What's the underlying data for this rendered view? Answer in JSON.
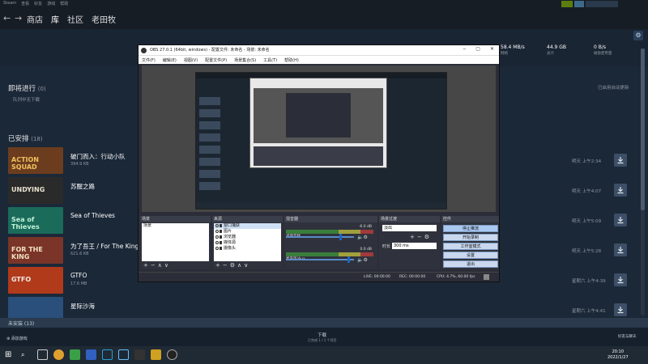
{
  "steam": {
    "top_menu": [
      "Steam",
      "查看",
      "好友",
      "游戏",
      "帮助"
    ],
    "nav": {
      "back": "←",
      "forward": "→",
      "links": [
        "商店",
        "库",
        "社区",
        "老田牧"
      ]
    },
    "stats": [
      {
        "value": "58.4 MB/s",
        "label": "网络"
      },
      {
        "value": "44.9 GB",
        "label": "总计"
      },
      {
        "value": "0 B/s",
        "label": "磁盘使用量"
      }
    ],
    "in_progress": {
      "title": "即将进行",
      "count": "(0)",
      "empty": "队列中无下载",
      "right_label": "已启用自动更新"
    },
    "installed": {
      "title": "已安排",
      "count": "(18)"
    },
    "games": [
      {
        "title": "破门而入：行动小队",
        "size": "394.9 KB",
        "time": "明天 上午2:34",
        "thumb_bg": "#6b3d1e",
        "thumb_text": "ACTION SQUAD",
        "thumb_fg": "#f0c060"
      },
      {
        "title": "苏醒之路",
        "size": "",
        "time": "明天 上午4:07",
        "thumb_bg": "#2a2a2a",
        "thumb_text": "UNDYING",
        "thumb_fg": "#e8e0d0"
      },
      {
        "title": "Sea of Thieves",
        "size": "",
        "time": "明天 上午5:09",
        "thumb_bg": "#1b6b5a",
        "thumb_text": "Sea of Thieves",
        "thumb_fg": "#c0f0d8"
      },
      {
        "title": "为了吾王 / For The King",
        "size": "621.6 KB",
        "time": "明天 上午5:28",
        "thumb_bg": "#7a3528",
        "thumb_text": "FOR THE KING",
        "thumb_fg": "#f0e0c0"
      },
      {
        "title": "GTFO",
        "size": "17.6 MB",
        "time": "星期六 上午4:39",
        "thumb_bg": "#b03a1a",
        "thumb_text": "GTFO",
        "thumb_fg": "#f0e8e0"
      },
      {
        "title": "星际沙海",
        "size": "",
        "time": "星期六 上午4:41",
        "thumb_bg": "#2a4f7a",
        "thumb_text": "",
        "thumb_fg": "#ffffff"
      }
    ],
    "uninstalled": "未安装 (13)",
    "bottom": {
      "center": "下载",
      "center_sub": "已完成 1 / 1 个项目",
      "left": "添加游戏",
      "right": "好友与聊天"
    }
  },
  "obs": {
    "title": "OBS 27.0.1 (64bit, windows) - 配置文件: 未命名 - 场景: 未命名",
    "menu": [
      "文件(F)",
      "编辑(E)",
      "视图(V)",
      "配置文件(P)",
      "场景集合(S)",
      "工具(T)",
      "帮助(H)"
    ],
    "docks": {
      "scenes": {
        "title": "场景",
        "items": [
          "场景"
        ]
      },
      "sources": {
        "title": "来源",
        "items": [
          "窗口捕获",
          "图片",
          "浏览器",
          "媒体源",
          "摄像头"
        ]
      },
      "mixer": {
        "title": "混音器",
        "ch1": {
          "name": "桌面音频",
          "db": "-6.0 dB"
        },
        "ch2": {
          "name": "麦克风/Aux",
          "db": "0.0 dB"
        }
      },
      "transitions": {
        "title": "场景过渡",
        "type": "淡出",
        "duration_label": "时长",
        "duration": "300 ms"
      },
      "controls": {
        "title": "控件",
        "buttons": [
          "停止推流",
          "开始录制",
          "工作室模式",
          "设置",
          "退出"
        ]
      }
    },
    "status": {
      "live": "LIVE: 00:00:00",
      "rec": "REC: 00:00:00",
      "cpu": "CPU: 4.7%, 60.00 fps"
    }
  },
  "taskbar": {
    "time": "20:10",
    "date": "2022/1/27"
  }
}
